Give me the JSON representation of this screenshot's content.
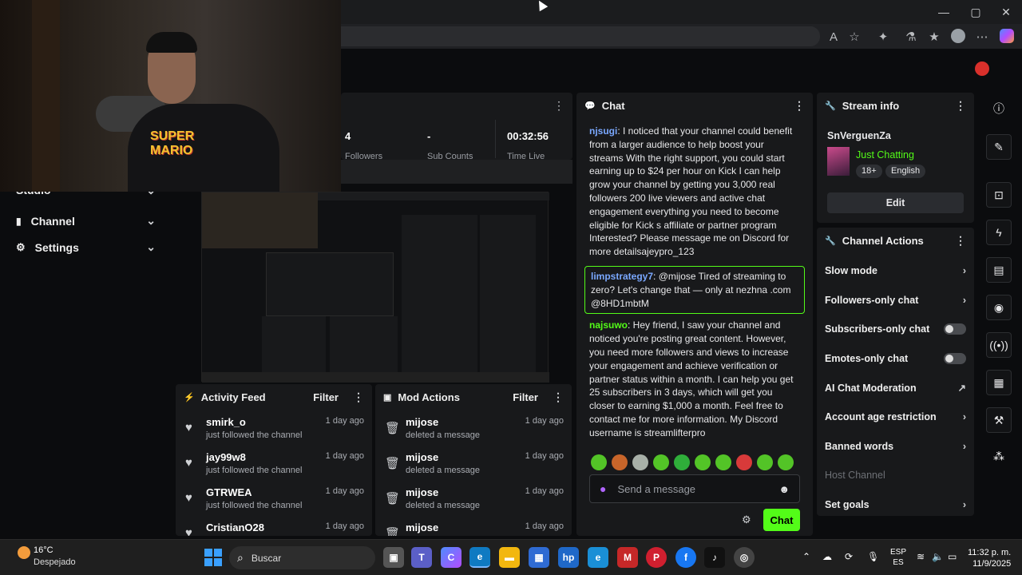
{
  "browser": {
    "reader_icon": "reader-icon",
    "favorite_icon": "star-icon",
    "extensions_icon": "puzzle-icon",
    "minimize": "—",
    "maximize": "▢",
    "close": "✕"
  },
  "sidebar": {
    "items": [
      {
        "label": "Studio"
      },
      {
        "label": "Channel"
      },
      {
        "label": "Settings"
      }
    ]
  },
  "stats": {
    "followers_value": "4",
    "followers_label": "Followers",
    "subs_value": "-",
    "subs_label": "Sub Counts",
    "time_value": "00:32:56",
    "time_label": "Time Live"
  },
  "activity_feed": {
    "title": "Activity Feed",
    "filter": "Filter",
    "items": [
      {
        "name": "smirk_o",
        "sub": "just followed the channel",
        "time": "1 day ago"
      },
      {
        "name": "jay99w8",
        "sub": "just followed the channel",
        "time": "1 day ago"
      },
      {
        "name": "GTRWEA",
        "sub": "just followed the channel",
        "time": "1 day ago"
      },
      {
        "name": "CristianO28",
        "sub": "",
        "time": "1 day ago"
      }
    ]
  },
  "mod_actions": {
    "title": "Mod Actions",
    "filter": "Filter",
    "items": [
      {
        "name": "mijose",
        "sub": "deleted a message",
        "time": "1 day ago"
      },
      {
        "name": "mijose",
        "sub": "deleted a message",
        "time": "1 day ago"
      },
      {
        "name": "mijose",
        "sub": "deleted a message",
        "time": "1 day ago"
      },
      {
        "name": "mijose",
        "sub": "",
        "time": "1 day ago"
      }
    ]
  },
  "chat": {
    "title": "Chat",
    "messages": [
      {
        "user": "njsugi",
        "text": ": I noticed that your channel could benefit from a larger audience to help boost your streams With the right support, you could start earning up to $24 per hour on Kick I can help grow your channel by getting you 3,000 real followers 200 live viewers and active chat engagement everything you need to become eligible for Kick s affiliate or partner program Interested? Please message me on Discord for more detailsajeypro_123"
      },
      {
        "user": "limpstrategy7",
        "text": ": @mijose Tired of streaming to zero? Let's change that — only at nezhna .com @8HD1mbtM"
      },
      {
        "user": "najsuwo",
        "text": ": Hey friend, I saw your channel and noticed you're posting great content. However, you need more followers and views to increase your engagement and achieve verification or partner status within a month. I can help you get 25 subscribers in 3 days, which will get you closer to earning $1,000 a month. Feel free to contact me for more information. My Discord username is streamlifterpro"
      }
    ],
    "input_placeholder": "Send a message",
    "send_label": "Chat"
  },
  "stream_info": {
    "title": "Stream info",
    "channel_name": "SnVerguenZa",
    "category": "Just Chatting",
    "tags": [
      "18+",
      "English"
    ],
    "edit_label": "Edit"
  },
  "channel_actions": {
    "title": "Channel Actions",
    "items": [
      {
        "label": "Slow mode",
        "type": "chevron"
      },
      {
        "label": "Followers-only chat",
        "type": "chevron"
      },
      {
        "label": "Subscribers-only chat",
        "type": "toggle"
      },
      {
        "label": "Emotes-only chat",
        "type": "toggle"
      },
      {
        "label": "AI Chat Moderation",
        "type": "external"
      },
      {
        "label": "Account age restriction",
        "type": "chevron"
      },
      {
        "label": "Banned words",
        "type": "chevron"
      },
      {
        "label": "Host Channel",
        "type": "disabled"
      },
      {
        "label": "Set goals",
        "type": "chevron"
      }
    ]
  },
  "webcam_overlay": {
    "shirt_text": "SUPER MARIO"
  },
  "taskbar": {
    "weather_temp": "16°C",
    "weather_desc": "Despejado",
    "search_label": "Buscar",
    "lang_top": "ESP",
    "lang_bottom": "ES",
    "time": "11:32 p. m.",
    "date": "11/9/2025"
  },
  "colors": {
    "accent": "#53fc18",
    "panel": "#18191b",
    "background": "#0b0c0e"
  }
}
